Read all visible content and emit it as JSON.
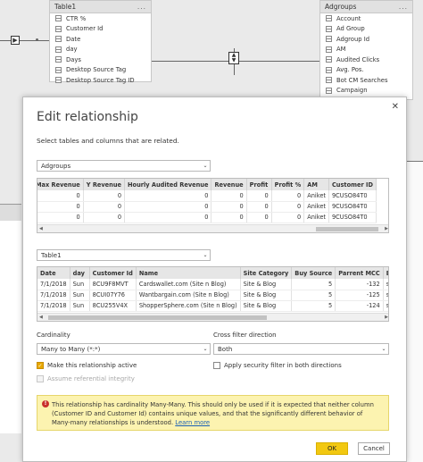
{
  "background": {
    "table1": {
      "title": "Table1",
      "more": "...",
      "fields": [
        "CTR %",
        "Customer Id",
        "Date",
        "day",
        "Days",
        "Desktop Source Tag",
        "Desktop Source Tag ID"
      ]
    },
    "adgroups": {
      "title": "Adgroups",
      "more": "...",
      "fields": [
        "Account",
        "Ad Group",
        "Adgroup Id",
        "AM",
        "Audited Clicks",
        "Avg. Pos.",
        "Bot CM Searches",
        "Campaign"
      ]
    },
    "relationship_glyph": "▶",
    "direction_glyph_up": "▲",
    "direction_glyph_down": "▼"
  },
  "dialog": {
    "title": "Edit relationship",
    "subtitle": "Select tables and columns that are related.",
    "close_glyph": "✕",
    "table_a": {
      "selected": "Adgroups",
      "columns": [
        "Max Revenue",
        "Y Revenue",
        "Hourly Audited Revenue",
        "Revenue",
        "Profit",
        "Profit %",
        "AM",
        "Customer ID"
      ],
      "rows": [
        [
          "0",
          "0",
          "0",
          "0",
          "0",
          "0",
          "Aniket",
          "9CUSO84T0"
        ],
        [
          "0",
          "0",
          "0",
          "0",
          "0",
          "0",
          "Aniket",
          "9CUSO84T0"
        ],
        [
          "0",
          "0",
          "0",
          "0",
          "0",
          "0",
          "Aniket",
          "9CUSO84T0"
        ]
      ]
    },
    "table_b": {
      "selected": "Table1",
      "columns": [
        "Date",
        "day",
        "Customer Id",
        "Name",
        "Site Category",
        "Buy Source",
        "Parrent MCC",
        "Buy T"
      ],
      "rows": [
        [
          "7/1/2018",
          "Sun",
          "8CU9F8MVT",
          "Cardswallet.com (Site n Blog)",
          "Site & Blog",
          "5",
          "-132",
          "searc"
        ],
        [
          "7/1/2018",
          "Sun",
          "8CUI07Y76",
          "Wantbargain.com (Site n Blog)",
          "Site & Blog",
          "5",
          "-125",
          "searc"
        ],
        [
          "7/1/2018",
          "Sun",
          "8CU255V4X",
          "ShopperSphere.com (Site n Blog)",
          "Site & Blog",
          "5",
          "-124",
          "searc"
        ]
      ]
    },
    "cardinality": {
      "label": "Cardinality",
      "value": "Many to Many (*:*)"
    },
    "cross_filter": {
      "label": "Cross filter direction",
      "value": "Both"
    },
    "make_active": {
      "label": "Make this relationship active",
      "checked": true
    },
    "security_filter": {
      "label": "Apply security filter in both directions",
      "checked": false
    },
    "referential_integrity": {
      "label": "Assume referential integrity",
      "checked": false
    },
    "warning": {
      "text": "This relationship has cardinality Many-Many. This should only be used if it is expected that neither column (Customer ID and Customer Id) contains unique values, and that the significantly different behavior of Many-many relationships is understood.",
      "link": "Learn more"
    },
    "ok_label": "OK",
    "cancel_label": "Cancel",
    "checkmark": "✓",
    "chevron": "⌄",
    "scroll_left": "◀",
    "scroll_right": "▶"
  },
  "colors": {
    "accent": "#f2c811",
    "warning_bg": "#fcf3b0",
    "error_icon": "#c9302c"
  }
}
